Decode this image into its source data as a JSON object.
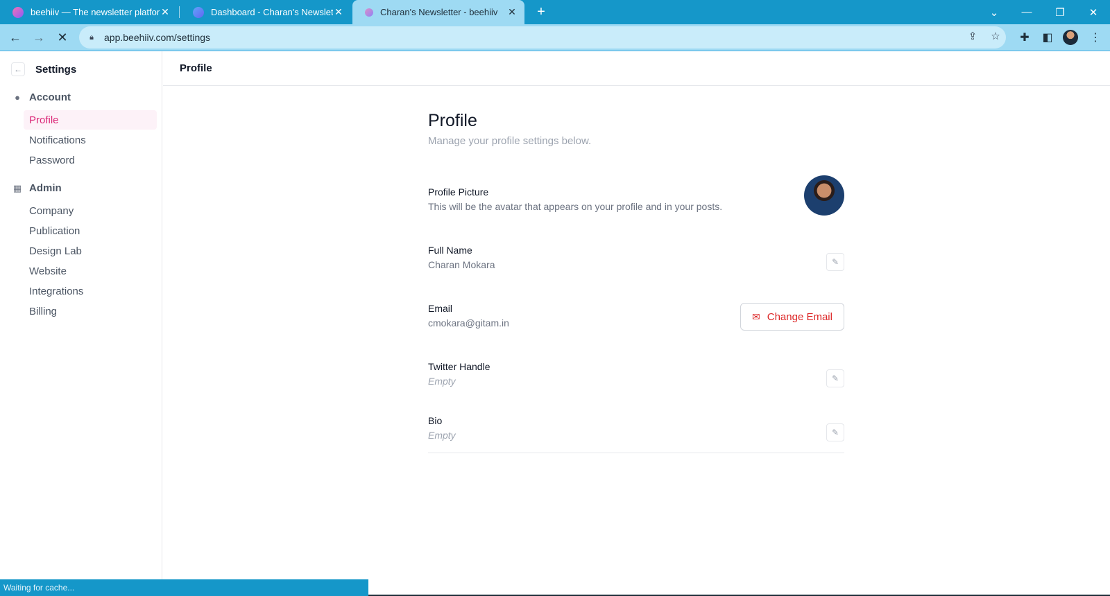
{
  "browser": {
    "tabs": [
      {
        "title": "beehiiv — The newsletter platform",
        "active": false
      },
      {
        "title": "Dashboard - Charan's Newsletter",
        "active": false
      },
      {
        "title": "Charan's Newsletter - beehiiv",
        "active": true
      }
    ],
    "url": "app.beehiiv.com/settings",
    "status_text": "Waiting for cache..."
  },
  "sidebar": {
    "title": "Settings",
    "groups": [
      {
        "label": "Account",
        "icon": "user-circle-icon",
        "items": [
          {
            "label": "Profile",
            "active": true
          },
          {
            "label": "Notifications"
          },
          {
            "label": "Password"
          }
        ]
      },
      {
        "label": "Admin",
        "icon": "building-icon",
        "items": [
          {
            "label": "Company"
          },
          {
            "label": "Publication"
          },
          {
            "label": "Design Lab"
          },
          {
            "label": "Website"
          },
          {
            "label": "Integrations"
          },
          {
            "label": "Billing"
          }
        ]
      }
    ]
  },
  "header": {
    "title": "Profile"
  },
  "profile": {
    "title": "Profile",
    "subtitle": "Manage your profile settings below.",
    "picture": {
      "label": "Profile Picture",
      "description": "This will be the avatar that appears on your profile and in your posts."
    },
    "full_name": {
      "label": "Full Name",
      "value": "Charan Mokara"
    },
    "email": {
      "label": "Email",
      "value": "cmokara@gitam.in",
      "button": "Change Email"
    },
    "twitter": {
      "label": "Twitter Handle",
      "value": "Empty"
    },
    "bio": {
      "label": "Bio",
      "value": "Empty"
    }
  },
  "colors": {
    "accent": "#db2777",
    "danger": "#dc2626",
    "chrome": "#1597c9"
  }
}
